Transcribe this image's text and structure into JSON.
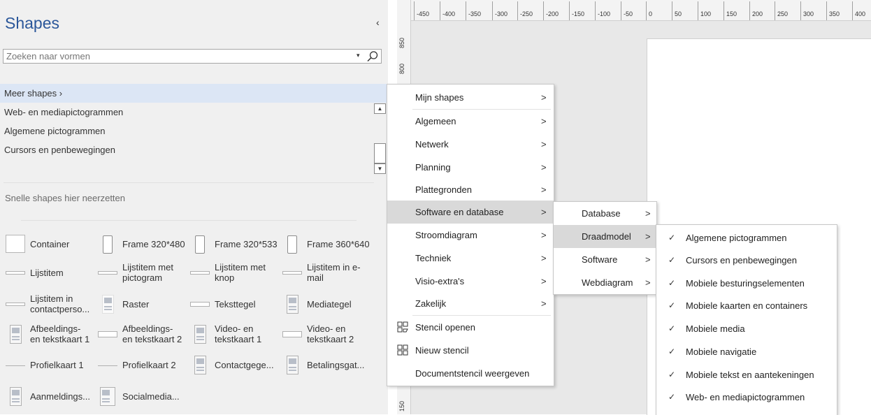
{
  "pane": {
    "title": "Shapes",
    "collapse_glyph": "‹",
    "search": {
      "value": "",
      "placeholder": "Zoeken naar vormen",
      "icon": "search-icon"
    },
    "stencils": [
      {
        "label": "Meer shapes  ›",
        "selected": true
      },
      {
        "label": "Web- en mediapictogrammen",
        "selected": false
      },
      {
        "label": "Algemene pictogrammen",
        "selected": false
      },
      {
        "label": "Cursors en penbewegingen",
        "selected": false
      }
    ],
    "quick_shapes_hint": "Snelle shapes hier neerzetten",
    "shapes": [
      {
        "label": "Container",
        "icon": "container-icon"
      },
      {
        "label": "Frame 320*480",
        "icon": "phone-frame-icon"
      },
      {
        "label": "Frame 320*533",
        "icon": "phone-frame-icon"
      },
      {
        "label": "Frame 360*640",
        "icon": "phone-frame-icon"
      },
      {
        "label": "Lijstitem",
        "icon": "list-item-icon"
      },
      {
        "label": "Lijstitem met pictogram",
        "icon": "list-item-icon"
      },
      {
        "label": "Lijstitem met knop",
        "icon": "list-item-icon"
      },
      {
        "label": "Lijstitem in e-mail",
        "icon": "list-item-icon"
      },
      {
        "label": "Lijstitem in contactperso...",
        "icon": "list-item-icon"
      },
      {
        "label": "Raster",
        "icon": "grid-icon"
      },
      {
        "label": "Teksttegel",
        "icon": "text-tile-icon"
      },
      {
        "label": "Mediategel",
        "icon": "media-tile-icon"
      },
      {
        "label": "Afbeeldings- en tekstkaart 1",
        "icon": "card-icon"
      },
      {
        "label": "Afbeeldings- en tekstkaart 2",
        "icon": "card-icon"
      },
      {
        "label": "Video- en tekstkaart 1",
        "icon": "card-icon"
      },
      {
        "label": "Video- en tekstkaart 2",
        "icon": "card-icon"
      },
      {
        "label": "Profielkaart 1",
        "icon": "list-item-icon"
      },
      {
        "label": "Profielkaart 2",
        "icon": "list-item-icon"
      },
      {
        "label": "Contactgege...",
        "icon": "card-icon"
      },
      {
        "label": "Betalingsgat...",
        "icon": "card-icon"
      },
      {
        "label": "Aanmeldings...",
        "icon": "card-icon"
      },
      {
        "label": "Socialmedia...",
        "icon": "card-icon"
      }
    ]
  },
  "rulers": {
    "top": [
      "-450",
      "-400",
      "-350",
      "-300",
      "-250",
      "-200",
      "-150",
      "-100",
      "-50",
      "0",
      "50",
      "100",
      "150",
      "200",
      "250",
      "300",
      "350",
      "400"
    ],
    "left": [
      "850",
      "800",
      "150"
    ]
  },
  "menu_main": {
    "items": [
      {
        "label": "Mijn shapes",
        "submenu": true
      },
      {
        "label": "Algemeen",
        "submenu": true
      },
      {
        "label": "Netwerk",
        "submenu": true
      },
      {
        "label": "Planning",
        "submenu": true
      },
      {
        "label": "Plattegronden",
        "submenu": true
      },
      {
        "label": "Software en database",
        "submenu": true,
        "highlighted": true
      },
      {
        "label": "Stroomdiagram",
        "submenu": true
      },
      {
        "label": "Techniek",
        "submenu": true
      },
      {
        "label": "Visio-extra's",
        "submenu": true
      },
      {
        "label": "Zakelijk",
        "submenu": true
      },
      {
        "label": "Stencil openen",
        "icon": "open-stencil-icon"
      },
      {
        "label": "Nieuw stencil",
        "icon": "new-stencil-icon"
      },
      {
        "label": "Documentstencil weergeven"
      }
    ]
  },
  "menu_software": {
    "items": [
      {
        "label": "Database"
      },
      {
        "label": "Draadmodel",
        "highlighted": true
      },
      {
        "label": "Software"
      },
      {
        "label": "Webdiagram"
      }
    ]
  },
  "menu_wireframe": {
    "items": [
      {
        "label": "Algemene pictogrammen",
        "checked": true
      },
      {
        "label": "Cursors en penbewegingen",
        "checked": true
      },
      {
        "label": "Mobiele besturingselementen",
        "checked": true
      },
      {
        "label": "Mobiele kaarten en containers",
        "checked": true
      },
      {
        "label": "Mobiele media",
        "checked": true
      },
      {
        "label": "Mobiele navigatie",
        "checked": true
      },
      {
        "label": "Mobiele tekst en aantekeningen",
        "checked": true
      },
      {
        "label": "Web- en mediapictogrammen",
        "checked": true
      }
    ]
  },
  "glyphs": {
    "submenu_arrow": ">",
    "check": "✓",
    "dropdown": "▾",
    "scroll_up": "▲",
    "scroll_down": "▼"
  }
}
